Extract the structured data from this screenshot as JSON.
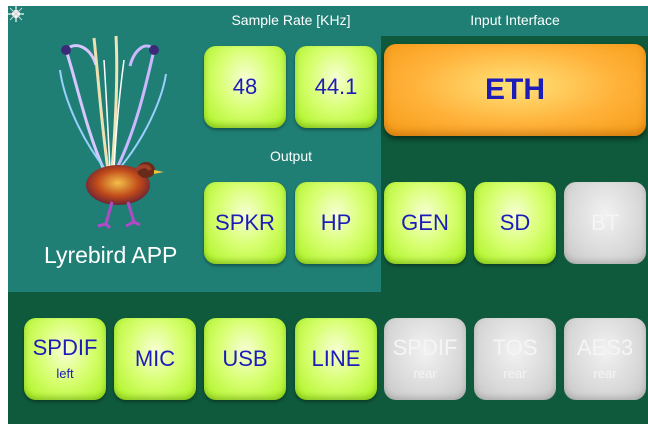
{
  "app": {
    "name": "Lyrebird APP"
  },
  "labels": {
    "sample_rate": "Sample Rate [KHz]",
    "input_interface": "Input Interface",
    "output": "Output"
  },
  "sample_rate": {
    "opt1": "48",
    "opt2": "44.1"
  },
  "input": {
    "eth": "ETH"
  },
  "output": {
    "spkr": "SPKR",
    "hp": "HP"
  },
  "sources": {
    "gen": "GEN",
    "sd": "SD",
    "bt": "BT",
    "spdif_left": {
      "main": "SPDIF",
      "sub": "left"
    },
    "mic": "MIC",
    "usb": "USB",
    "line": "LINE",
    "spdif_rear": {
      "main": "SPDIF",
      "sub": "rear"
    },
    "tos_rear": {
      "main": "TOS",
      "sub": "rear"
    },
    "aes3_rear": {
      "main": "AES3",
      "sub": "rear"
    }
  },
  "colors": {
    "active_button": "#c8ff4a",
    "inactive_button": "#d4d4d4",
    "eth_button": "#ffb23a",
    "teal_panel": "#1f7f75",
    "dark_panel": "#0f5a3c",
    "button_text": "#1c1cb8"
  },
  "icons": {
    "corner": "sparkle-icon",
    "logo": "lyrebird-logo"
  }
}
